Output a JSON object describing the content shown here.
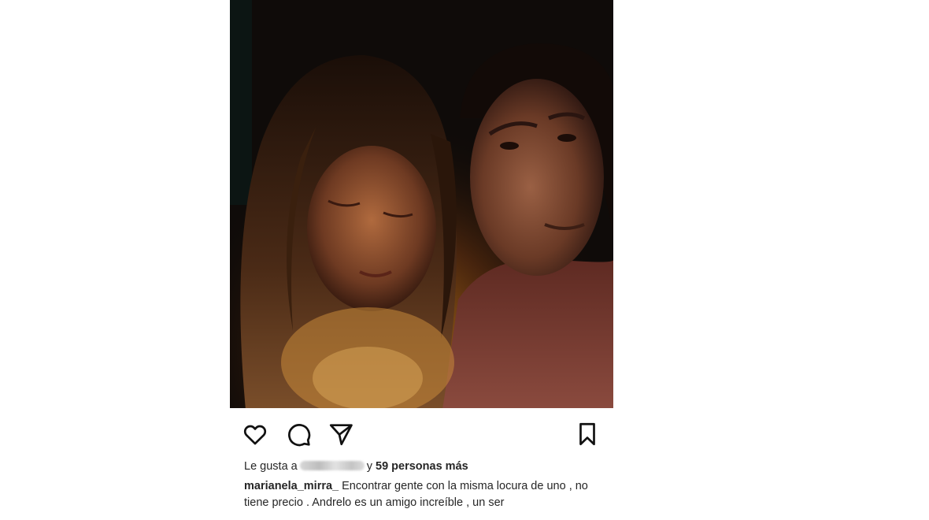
{
  "post": {
    "likes": {
      "prefix": "Le gusta a",
      "connector": "y",
      "count_text": "59 personas más"
    },
    "caption": {
      "username": "marianela_mirra_",
      "text": "Encontrar gente con la misma locura de uno , no tiene precio . Andrelo es un amigo increíble , un ser"
    }
  },
  "icons": [
    "heart-icon",
    "comment-icon",
    "share-icon",
    "bookmark-icon"
  ],
  "colors": {
    "text": "#262626",
    "background": "#ffffff"
  }
}
